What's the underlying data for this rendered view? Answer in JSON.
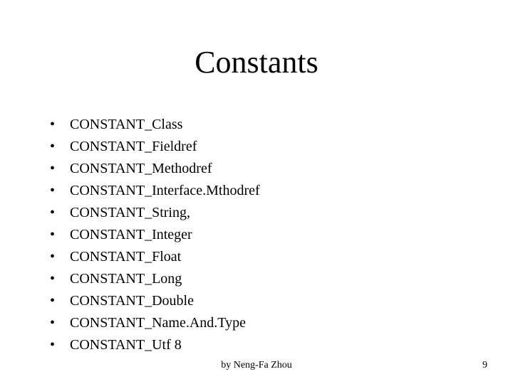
{
  "title": "Constants",
  "items": [
    "CONSTANT_Class",
    "CONSTANT_Fieldref",
    "CONSTANT_Methodref",
    "CONSTANT_Interface.Mthodref",
    "CONSTANT_String,",
    "CONSTANT_Integer",
    "CONSTANT_Float",
    "CONSTANT_Long",
    "CONSTANT_Double",
    "CONSTANT_Name.And.Type",
    "CONSTANT_Utf 8"
  ],
  "footer": {
    "author": "by Neng-Fa Zhou",
    "page": "9"
  }
}
